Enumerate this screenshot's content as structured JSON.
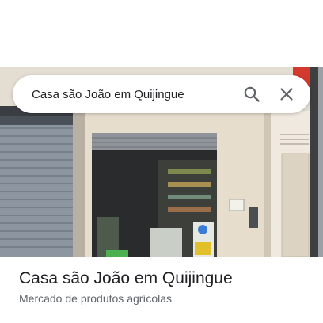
{
  "search": {
    "query": "Casa são João em Quijingue",
    "search_icon": "search-icon",
    "clear_icon": "close-icon"
  },
  "place": {
    "name": "Casa são João em Quijingue",
    "category": "Mercado de produtos agrícolas",
    "photo": "storefront-photo"
  },
  "colors": {
    "text_primary": "#202124",
    "text_secondary": "#5f6368",
    "icon": "#5f6368",
    "search_bg": "#ffffff"
  }
}
